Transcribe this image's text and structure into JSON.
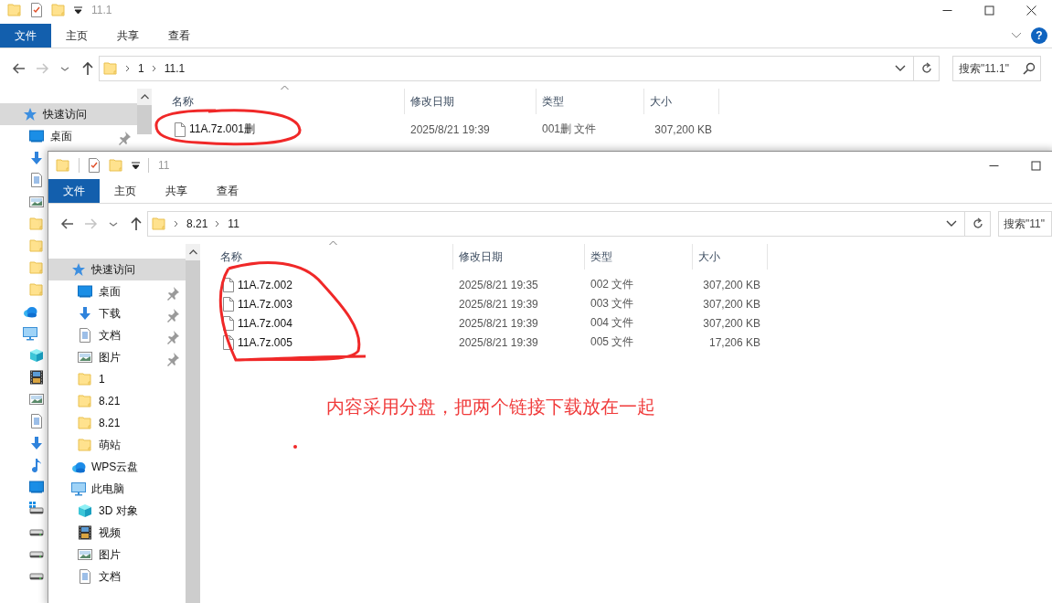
{
  "windows": [
    {
      "title": "11.1",
      "controls": [
        {
          "kind": "minimize"
        },
        {
          "kind": "maximize"
        },
        {
          "kind": "close"
        }
      ],
      "ribbon_tabs": [
        {
          "label": "文件",
          "selected": true
        },
        {
          "label": "主页",
          "selected": false
        },
        {
          "label": "共享",
          "selected": false
        },
        {
          "label": "查看",
          "selected": false
        }
      ],
      "help": "?",
      "breadcrumb": [
        "1",
        "11.1"
      ],
      "search": {
        "placeholder": "搜索\"11.1\""
      },
      "nav_items": [
        {
          "label": "快速访问",
          "kind": "star",
          "selected": true,
          "children": [
            {
              "label": "桌面",
              "kind": "desktop",
              "selected": false,
              "pinned": true
            },
            {
              "kind": "download",
              "selected": false
            },
            {
              "kind": "document",
              "selected": false
            },
            {
              "kind": "picture",
              "selected": false
            },
            {
              "kind": "folder",
              "selected": false
            },
            {
              "kind": "folder",
              "selected": false
            },
            {
              "kind": "folder",
              "selected": false
            },
            {
              "kind": "folder",
              "selected": false
            }
          ]
        },
        {
          "kind": "cloud",
          "selected": false
        },
        {
          "kind": "pc",
          "selected": false,
          "children": [
            {
              "kind": "cube",
              "selected": false
            },
            {
              "kind": "film",
              "selected": false
            },
            {
              "kind": "picture",
              "selected": false
            },
            {
              "kind": "document",
              "selected": false
            },
            {
              "kind": "download",
              "selected": false
            },
            {
              "kind": "music",
              "selected": false
            },
            {
              "kind": "desktop",
              "selected": false
            },
            {
              "kind": "drive-win",
              "selected": false
            },
            {
              "kind": "drive",
              "selected": false
            },
            {
              "kind": "drive",
              "selected": false
            },
            {
              "kind": "drive",
              "selected": false
            }
          ]
        }
      ],
      "columns": [
        "名称",
        "修改日期",
        "类型",
        "大小"
      ],
      "files": [
        {
          "name": "11A.7z.001删",
          "modified": "2025/8/21 19:39",
          "type": "001删 文件",
          "size": "307,200 KB"
        }
      ]
    },
    {
      "title": "11",
      "controls": [
        {
          "kind": "minimize"
        },
        {
          "kind": "maximize"
        }
      ],
      "ribbon_tabs": [
        {
          "label": "文件",
          "selected": true
        },
        {
          "label": "主页",
          "selected": false
        },
        {
          "label": "共享",
          "selected": false
        },
        {
          "label": "查看",
          "selected": false
        }
      ],
      "breadcrumb": [
        "8.21",
        "11"
      ],
      "search": {
        "placeholder": "搜索\"11\""
      },
      "nav_items": [
        {
          "label": "快速访问",
          "kind": "star",
          "selected": true,
          "children": [
            {
              "label": "桌面",
              "kind": "desktop",
              "selected": false,
              "pinned": true
            },
            {
              "label": "下载",
              "kind": "download",
              "selected": false,
              "pinned": true
            },
            {
              "label": "文档",
              "kind": "document",
              "selected": false,
              "pinned": true
            },
            {
              "label": "图片",
              "kind": "picture",
              "selected": false,
              "pinned": true
            },
            {
              "label": "1",
              "kind": "folder",
              "selected": false,
              "pinned": false
            },
            {
              "label": "8.21",
              "kind": "folder",
              "selected": false,
              "pinned": false
            },
            {
              "label": "8.21",
              "kind": "folder",
              "selected": false,
              "pinned": false
            },
            {
              "label": "萌站",
              "kind": "folder",
              "selected": false,
              "pinned": false
            }
          ]
        },
        {
          "label": "WPS云盘",
          "kind": "cloud",
          "selected": false
        },
        {
          "label": "此电脑",
          "kind": "pc",
          "selected": false,
          "children": [
            {
              "label": "3D 对象",
              "kind": "cube",
              "selected": false
            },
            {
              "label": "视频",
              "kind": "film",
              "selected": false
            },
            {
              "label": "图片",
              "kind": "picture",
              "selected": false
            },
            {
              "label": "文档",
              "kind": "document",
              "selected": false
            }
          ]
        }
      ],
      "columns": [
        "名称",
        "修改日期",
        "类型",
        "大小"
      ],
      "files": [
        {
          "name": "11A.7z.002",
          "modified": "2025/8/21 19:35",
          "type": "002 文件",
          "size": "307,200 KB"
        },
        {
          "name": "11A.7z.003",
          "modified": "2025/8/21 19:39",
          "type": "003 文件",
          "size": "307,200 KB"
        },
        {
          "name": "11A.7z.004",
          "modified": "2025/8/21 19:39",
          "type": "004 文件",
          "size": "307,200 KB"
        },
        {
          "name": "11A.7z.005",
          "modified": "2025/8/21 19:39",
          "type": "005 文件",
          "size": "17,206 KB"
        }
      ]
    }
  ],
  "annotation": {
    "note": "内容采用分盘，把两个链接下载放在一起"
  }
}
